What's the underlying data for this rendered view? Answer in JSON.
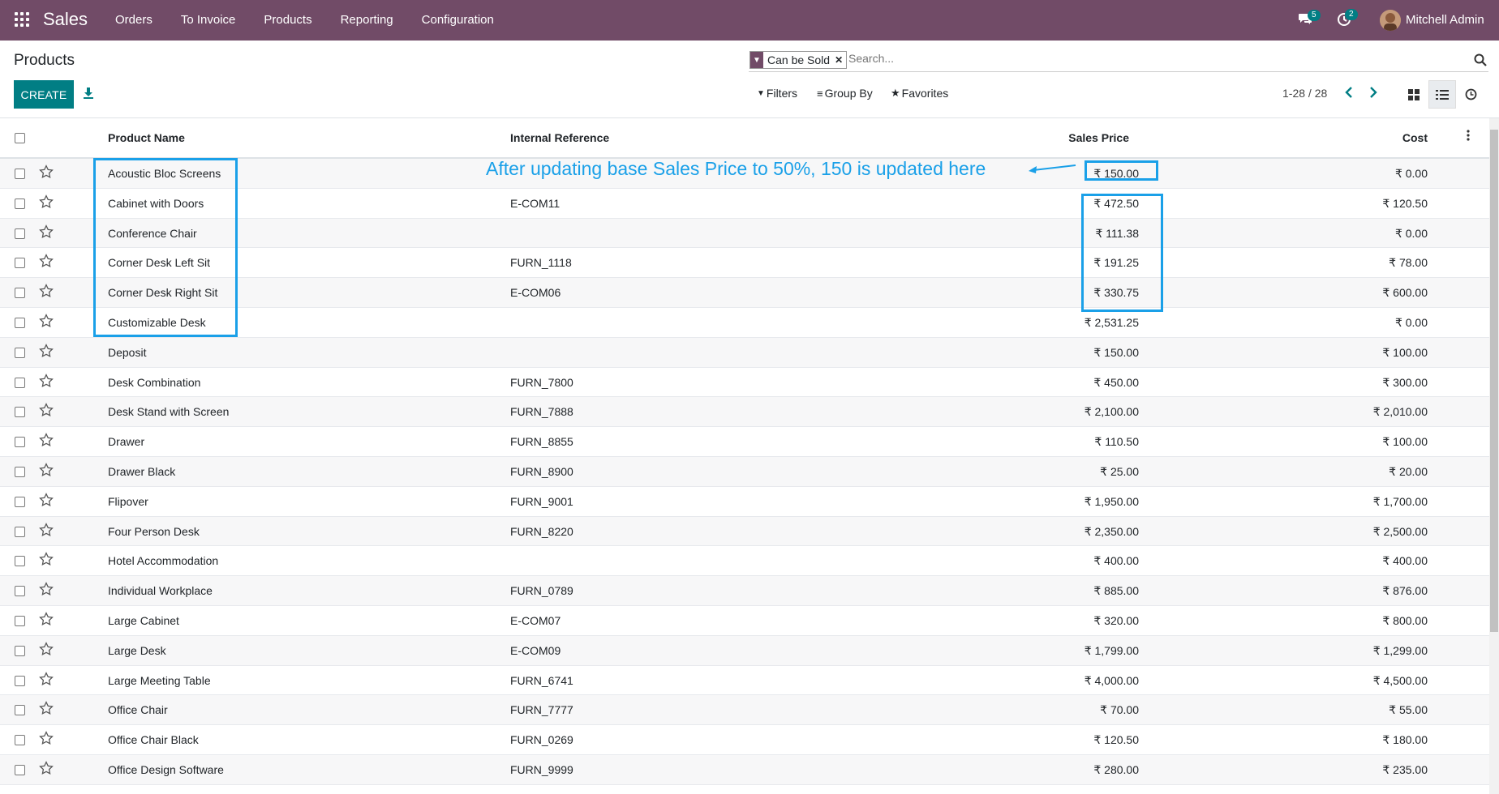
{
  "topbar": {
    "brand": "Sales",
    "menu": [
      "Orders",
      "To Invoice",
      "Products",
      "Reporting",
      "Configuration"
    ],
    "messages_count": "5",
    "activities_count": "2",
    "user_name": "Mitchell Admin"
  },
  "control_panel": {
    "title": "Products",
    "create_label": "CREATE",
    "search": {
      "facet_label": "Can be Sold",
      "placeholder": "Search..."
    },
    "filters_label": "Filters",
    "groupby_label": "Group By",
    "favorites_label": "Favorites",
    "pager": "1-28 / 28"
  },
  "table": {
    "headers": {
      "name": "Product Name",
      "ref": "Internal Reference",
      "price": "Sales Price",
      "cost": "Cost"
    },
    "rows": [
      {
        "name": "Acoustic Bloc Screens",
        "ref": "",
        "price": "₹ 150.00",
        "cost": "₹ 0.00"
      },
      {
        "name": "Cabinet with Doors",
        "ref": "E-COM11",
        "price": "₹ 472.50",
        "cost": "₹ 120.50"
      },
      {
        "name": "Conference Chair",
        "ref": "",
        "price": "₹ 111.38",
        "cost": "₹ 0.00"
      },
      {
        "name": "Corner Desk Left Sit",
        "ref": "FURN_1118",
        "price": "₹ 191.25",
        "cost": "₹ 78.00"
      },
      {
        "name": "Corner Desk Right Sit",
        "ref": "E-COM06",
        "price": "₹ 330.75",
        "cost": "₹ 600.00"
      },
      {
        "name": "Customizable Desk",
        "ref": "",
        "price": "₹ 2,531.25",
        "cost": "₹ 0.00"
      },
      {
        "name": "Deposit",
        "ref": "",
        "price": "₹ 150.00",
        "cost": "₹ 100.00"
      },
      {
        "name": "Desk Combination",
        "ref": "FURN_7800",
        "price": "₹ 450.00",
        "cost": "₹ 300.00"
      },
      {
        "name": "Desk Stand with Screen",
        "ref": "FURN_7888",
        "price": "₹ 2,100.00",
        "cost": "₹ 2,010.00"
      },
      {
        "name": "Drawer",
        "ref": "FURN_8855",
        "price": "₹ 110.50",
        "cost": "₹ 100.00"
      },
      {
        "name": "Drawer Black",
        "ref": "FURN_8900",
        "price": "₹ 25.00",
        "cost": "₹ 20.00"
      },
      {
        "name": "Flipover",
        "ref": "FURN_9001",
        "price": "₹ 1,950.00",
        "cost": "₹ 1,700.00"
      },
      {
        "name": "Four Person Desk",
        "ref": "FURN_8220",
        "price": "₹ 2,350.00",
        "cost": "₹ 2,500.00"
      },
      {
        "name": "Hotel Accommodation",
        "ref": "",
        "price": "₹ 400.00",
        "cost": "₹ 400.00"
      },
      {
        "name": "Individual Workplace",
        "ref": "FURN_0789",
        "price": "₹ 885.00",
        "cost": "₹ 876.00"
      },
      {
        "name": "Large Cabinet",
        "ref": "E-COM07",
        "price": "₹ 320.00",
        "cost": "₹ 800.00"
      },
      {
        "name": "Large Desk",
        "ref": "E-COM09",
        "price": "₹ 1,799.00",
        "cost": "₹ 1,299.00"
      },
      {
        "name": "Large Meeting Table",
        "ref": "FURN_6741",
        "price": "₹ 4,000.00",
        "cost": "₹ 4,500.00"
      },
      {
        "name": "Office Chair",
        "ref": "FURN_7777",
        "price": "₹ 70.00",
        "cost": "₹ 55.00"
      },
      {
        "name": "Office Chair Black",
        "ref": "FURN_0269",
        "price": "₹ 120.50",
        "cost": "₹ 180.00"
      },
      {
        "name": "Office Design Software",
        "ref": "FURN_9999",
        "price": "₹ 280.00",
        "cost": "₹ 235.00"
      }
    ]
  },
  "annotation": {
    "text": "After updating base Sales Price to 50%, 150 is updated here"
  },
  "colors": {
    "brand": "#714B67",
    "primary": "#017e84",
    "annotation": "#1aa0e8"
  }
}
